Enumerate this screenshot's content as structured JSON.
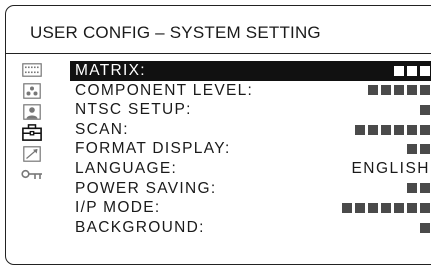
{
  "screen": {
    "title": "USER CONFIG – SYSTEM SETTING"
  },
  "sidebar": {
    "items": [
      {
        "icon": "picture-grid-icon",
        "selected": false
      },
      {
        "icon": "dots-cluster-icon",
        "selected": false
      },
      {
        "icon": "person-icon",
        "selected": false
      },
      {
        "icon": "toolbox-icon",
        "selected": true
      },
      {
        "icon": "arrow-diagonal-icon",
        "selected": false
      },
      {
        "icon": "key-icon",
        "selected": false
      }
    ]
  },
  "menu": {
    "items": [
      {
        "label": "MATRIX:",
        "blocks": 3,
        "selected": true
      },
      {
        "label": "COMPONENT LEVEL:",
        "blocks": 5
      },
      {
        "label": "NTSC SETUP:",
        "blocks": 1
      },
      {
        "label": "SCAN:",
        "blocks": 6
      },
      {
        "label": "FORMAT DISPLAY:",
        "blocks": 2
      },
      {
        "label": "LANGUAGE:",
        "value": "ENGLISH"
      },
      {
        "label": "POWER SAVING:",
        "blocks": 2
      },
      {
        "label": "I/P MODE:",
        "blocks": 7
      },
      {
        "label": "BACKGROUND:",
        "blocks": 1
      }
    ]
  },
  "colors": {
    "text": "#1a1a1a",
    "block": "#4a4a4a",
    "selection_bg": "#111111",
    "icon": "#777777",
    "icon_active": "#111111"
  }
}
